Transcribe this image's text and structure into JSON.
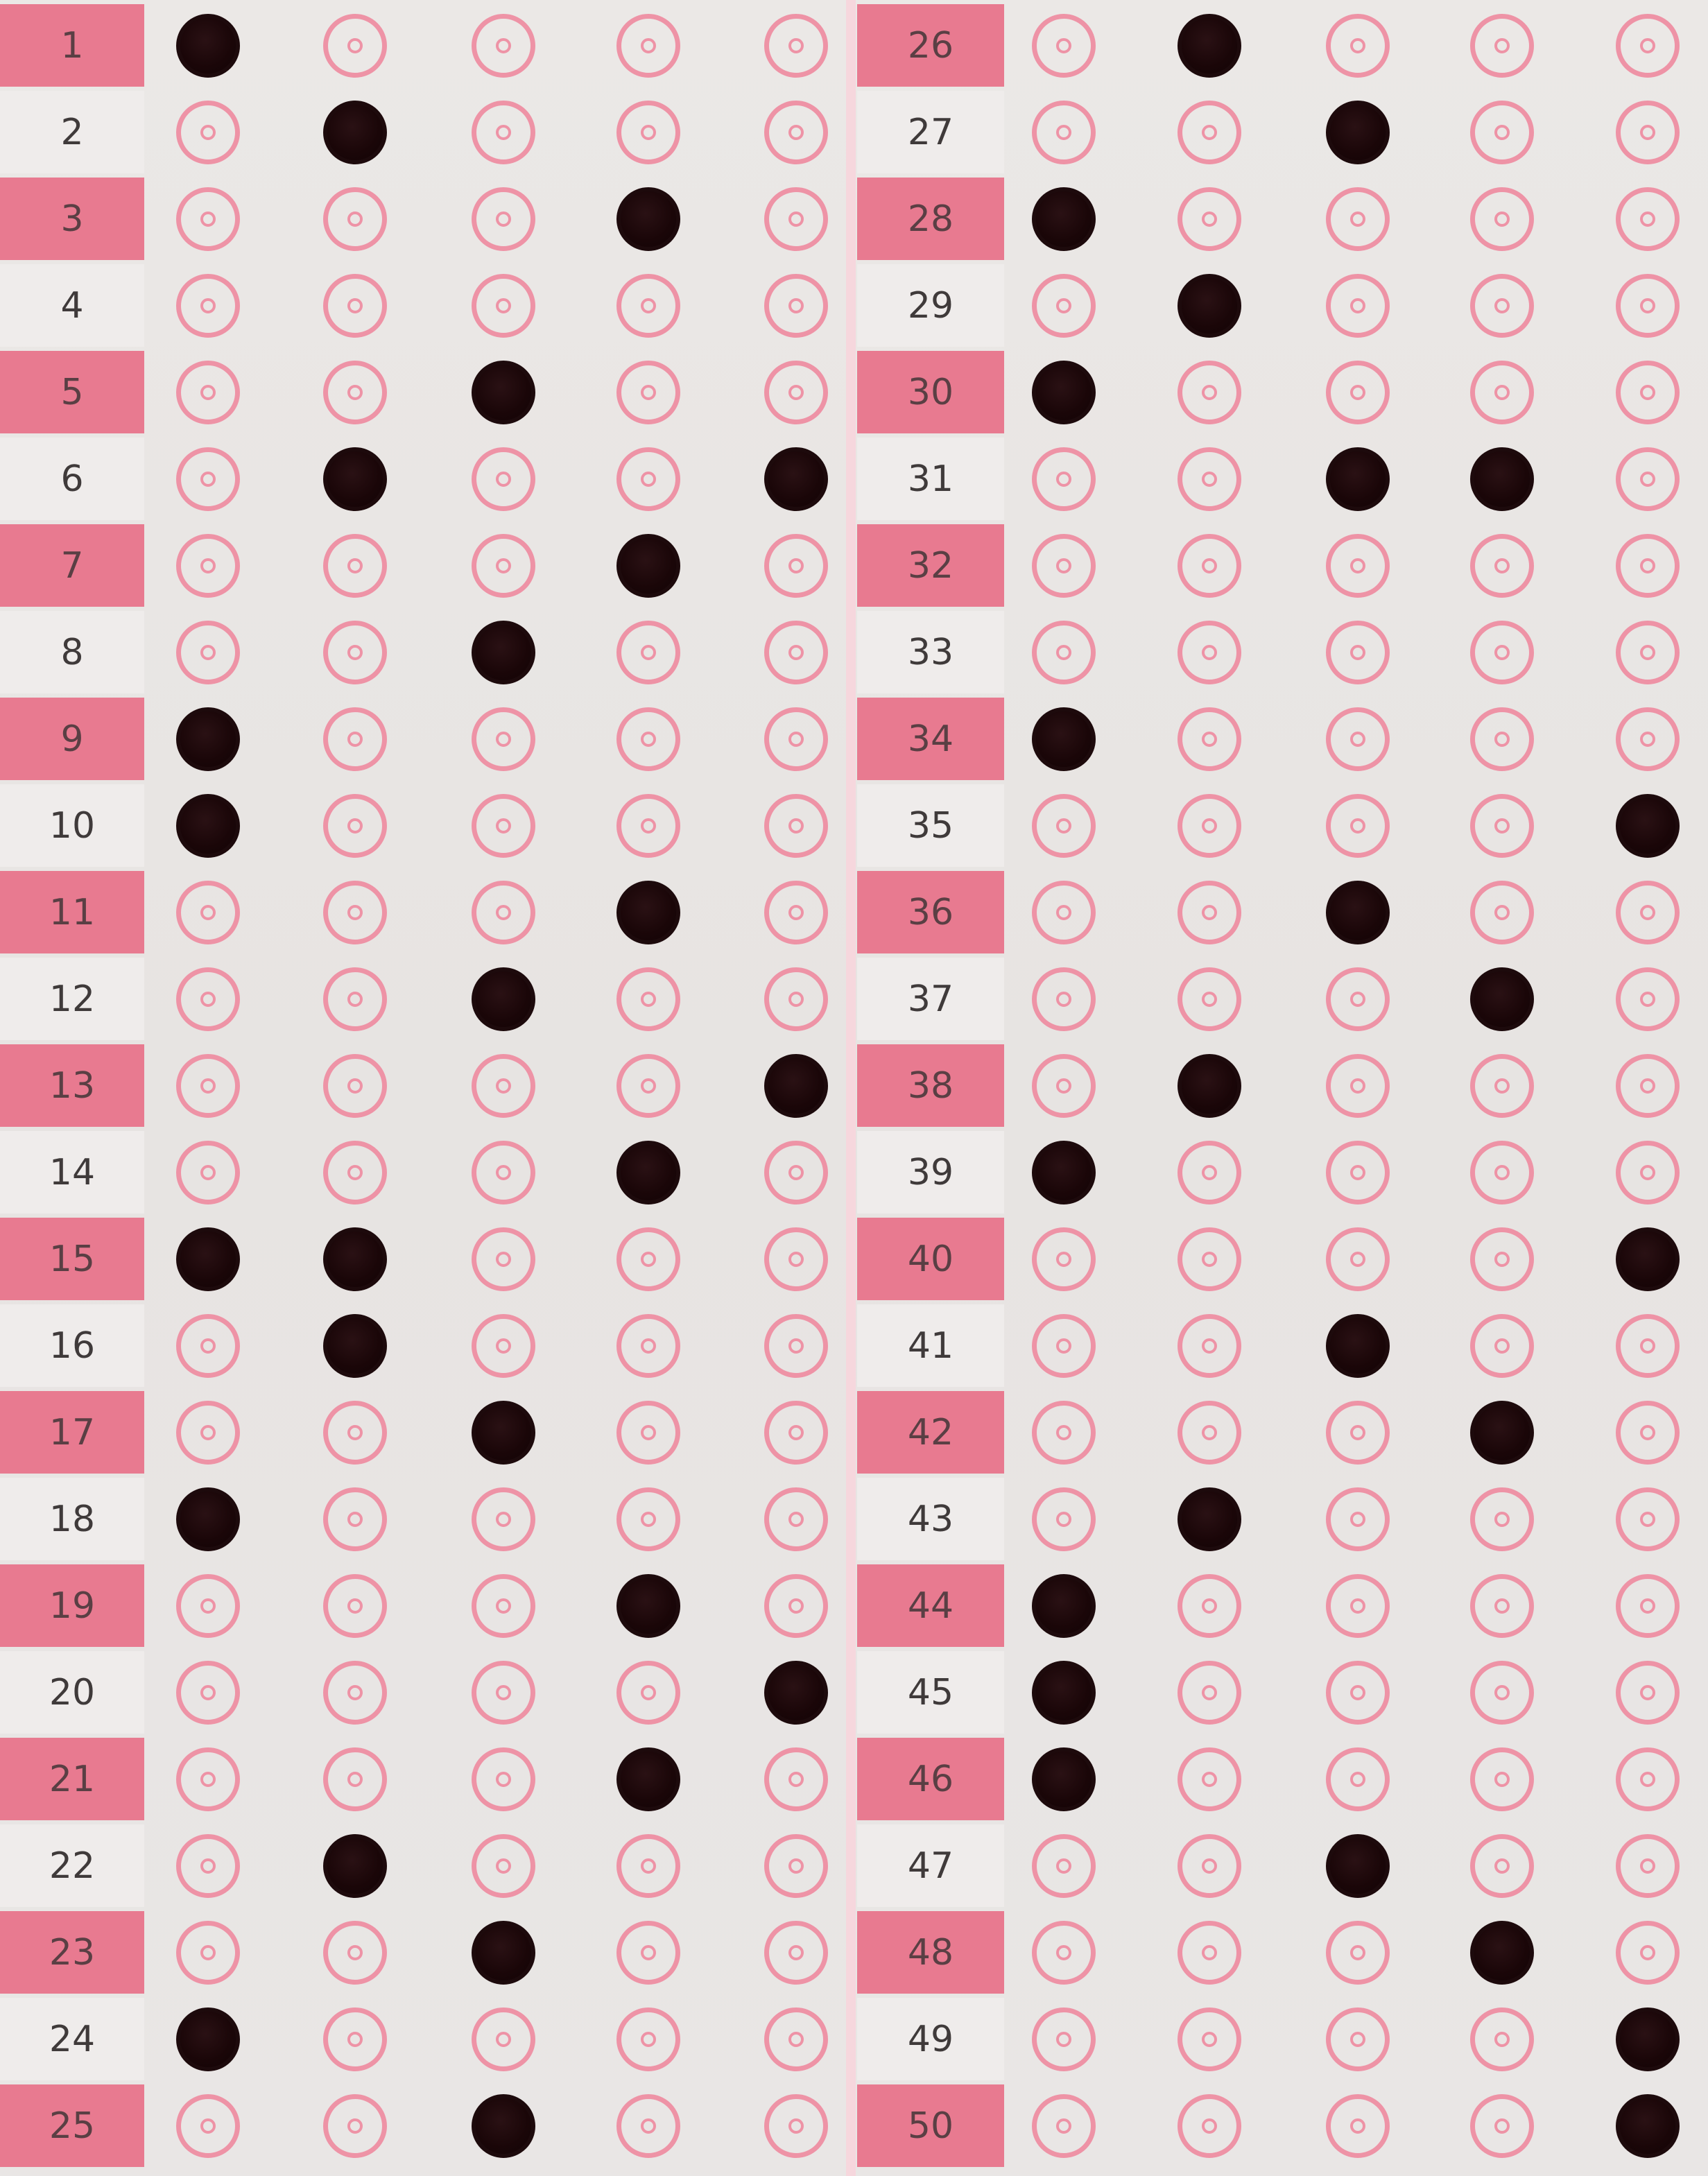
{
  "sheet": {
    "colors": {
      "row_pink": "#e87a90",
      "row_white": "#efeceb",
      "bubble_ring": "#ee93a6",
      "mark": "#1a0608"
    },
    "left_block": {
      "numbers": [
        "1",
        "2",
        "3",
        "4",
        "5",
        "6",
        "7",
        "8",
        "9",
        "10",
        "11",
        "12",
        "13",
        "14",
        "15",
        "16",
        "17",
        "18",
        "19",
        "20",
        "21",
        "22",
        "23",
        "24",
        "25"
      ],
      "marked": [
        [
          1
        ],
        [
          2
        ],
        [
          4
        ],
        [],
        [
          3
        ],
        [
          2,
          5
        ],
        [
          4
        ],
        [
          3
        ],
        [
          1
        ],
        [
          1
        ],
        [
          4
        ],
        [
          3
        ],
        [
          5
        ],
        [
          4
        ],
        [
          1,
          2
        ],
        [
          2
        ],
        [
          3
        ],
        [
          1
        ],
        [
          4
        ],
        [
          5
        ],
        [
          4
        ],
        [
          2
        ],
        [
          3
        ],
        [
          1
        ],
        [
          3
        ]
      ]
    },
    "right_block": {
      "numbers": [
        "26",
        "27",
        "28",
        "29",
        "30",
        "31",
        "32",
        "33",
        "34",
        "35",
        "36",
        "37",
        "38",
        "39",
        "40",
        "41",
        "42",
        "43",
        "44",
        "45",
        "46",
        "47",
        "48",
        "49",
        "50"
      ],
      "marked": [
        [
          2
        ],
        [
          3
        ],
        [
          1
        ],
        [
          2
        ],
        [
          1
        ],
        [
          3,
          4
        ],
        [],
        [],
        [
          1
        ],
        [
          5
        ],
        [
          3
        ],
        [
          4
        ],
        [
          2
        ],
        [
          1
        ],
        [
          5
        ],
        [
          3
        ],
        [
          4
        ],
        [
          2
        ],
        [
          1
        ],
        [
          1
        ],
        [
          1
        ],
        [
          3
        ],
        [
          4
        ],
        [
          5
        ],
        [
          5
        ]
      ]
    }
  }
}
